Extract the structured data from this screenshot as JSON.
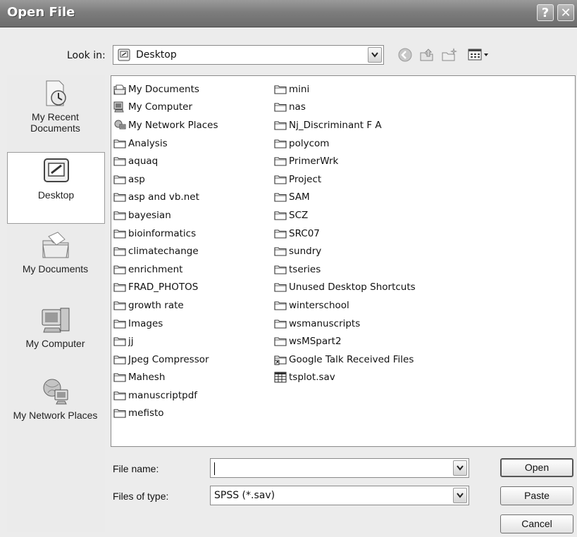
{
  "window": {
    "title": "Open File",
    "help_glyph": "?",
    "close_glyph": "✕"
  },
  "lookin": {
    "label": "Look in:",
    "value": "Desktop"
  },
  "places": [
    {
      "label": "My Recent Documents",
      "icon": "recent-documents-icon"
    },
    {
      "label": "Desktop",
      "icon": "desktop-icon",
      "selected": true
    },
    {
      "label": "My Documents",
      "icon": "my-documents-icon"
    },
    {
      "label": "My Computer",
      "icon": "my-computer-icon"
    },
    {
      "label": "My Network Places",
      "icon": "network-places-icon"
    }
  ],
  "files": {
    "column1": [
      {
        "name": "My Documents",
        "icon": "mydocs"
      },
      {
        "name": "My Computer",
        "icon": "computer"
      },
      {
        "name": "My Network Places",
        "icon": "network"
      },
      {
        "name": "Analysis",
        "icon": "folder"
      },
      {
        "name": "aquaq",
        "icon": "folder"
      },
      {
        "name": "asp",
        "icon": "folder"
      },
      {
        "name": "asp and vb.net",
        "icon": "folder"
      },
      {
        "name": "bayesian",
        "icon": "folder"
      },
      {
        "name": "bioinformatics",
        "icon": "folder"
      },
      {
        "name": "climatechange",
        "icon": "folder"
      },
      {
        "name": "enrichment",
        "icon": "folder"
      },
      {
        "name": "FRAD_PHOTOS",
        "icon": "folder"
      },
      {
        "name": "growth rate",
        "icon": "folder"
      },
      {
        "name": "Images",
        "icon": "folder"
      },
      {
        "name": "jj",
        "icon": "folder"
      },
      {
        "name": "Jpeg Compressor",
        "icon": "folder"
      },
      {
        "name": "Mahesh",
        "icon": "folder"
      },
      {
        "name": "manuscriptpdf",
        "icon": "folder"
      },
      {
        "name": "mefisto",
        "icon": "folder"
      }
    ],
    "column2": [
      {
        "name": "mini",
        "icon": "folder"
      },
      {
        "name": "nas",
        "icon": "folder"
      },
      {
        "name": "Nj_Discriminant F A",
        "icon": "folder"
      },
      {
        "name": "polycom",
        "icon": "folder"
      },
      {
        "name": "PrimerWrk",
        "icon": "folder"
      },
      {
        "name": "Project",
        "icon": "folder"
      },
      {
        "name": "SAM",
        "icon": "folder"
      },
      {
        "name": "SCZ",
        "icon": "folder"
      },
      {
        "name": "SRC07",
        "icon": "folder"
      },
      {
        "name": "sundry",
        "icon": "folder"
      },
      {
        "name": "tseries",
        "icon": "folder"
      },
      {
        "name": "Unused Desktop Shortcuts",
        "icon": "folder"
      },
      {
        "name": "winterschool",
        "icon": "folder"
      },
      {
        "name": "wsmanuscripts",
        "icon": "folder"
      },
      {
        "name": "wsMSpart2",
        "icon": "folder"
      },
      {
        "name": "Google Talk Received Files",
        "icon": "shortcut-folder"
      },
      {
        "name": "tsplot.sav",
        "icon": "sav-file"
      }
    ]
  },
  "filename": {
    "label": "File name:",
    "value": ""
  },
  "filetype": {
    "label": "Files of type:",
    "value": "SPSS (*.sav)"
  },
  "buttons": {
    "open": "Open",
    "paste": "Paste",
    "cancel": "Cancel"
  }
}
